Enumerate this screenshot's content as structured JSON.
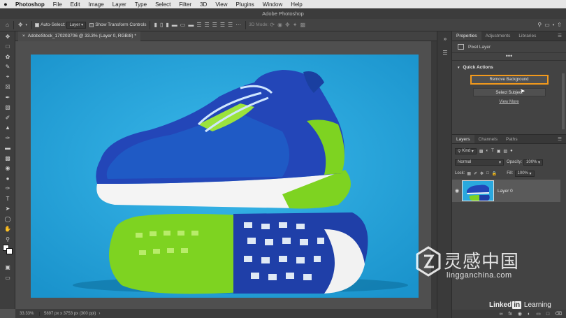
{
  "mac_menu": {
    "apple": "",
    "items": [
      "Photoshop",
      "File",
      "Edit",
      "Image",
      "Layer",
      "Type",
      "Select",
      "Filter",
      "3D",
      "View",
      "Plugins",
      "Window",
      "Help"
    ]
  },
  "window_title": "Adobe Photoshop",
  "options_bar": {
    "auto_select_label": "Auto-Select:",
    "auto_select_value": "Layer",
    "show_transform_label": "Show Transform Controls",
    "mode_3d_label": "3D Mode:"
  },
  "document": {
    "tab_title": "AdobeStock_170203706 @ 33.3% (Layer 0, RGB/8) *",
    "zoom": "33.33%",
    "info": "5897 px x 3753 px (300 ppi)"
  },
  "properties_panel": {
    "tabs": [
      "Properties",
      "Adjustments",
      "Libraries"
    ],
    "layer_type": "Pixel Layer",
    "more": "•••",
    "quick_actions_title": "Quick Actions",
    "remove_background": "Remove Background",
    "select_subject": "Select Subject",
    "view_more": "View More"
  },
  "layers_panel": {
    "tabs": [
      "Layers",
      "Channels",
      "Paths"
    ],
    "kind_label": "Kind",
    "blend_mode": "Normal",
    "opacity_label": "Opacity:",
    "opacity_value": "100%",
    "lock_label": "Lock:",
    "fill_label": "Fill:",
    "fill_value": "100%",
    "layers": [
      {
        "name": "Layer 0",
        "visible": true
      }
    ]
  },
  "watermark": {
    "chinese": "灵感中国",
    "url": "lingganchina.com"
  },
  "linkedin": {
    "linked": "Linked",
    "in": "in",
    "learning": "Learning"
  },
  "colors": {
    "canvas_blue": "#2aa8de",
    "highlight_orange": "#f39a1c",
    "ui_dark": "#434343"
  }
}
